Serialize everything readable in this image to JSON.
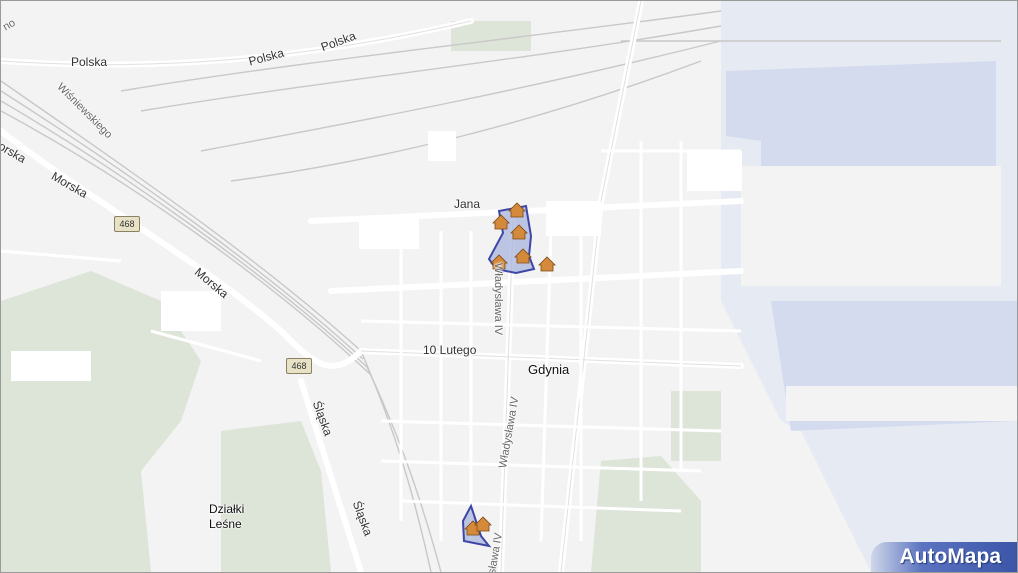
{
  "map": {
    "labels": {
      "polska_1": "Polska",
      "polska_2": "Polska",
      "polska_3": "Polska",
      "wisniewskiego": "Wiśniewskiego",
      "morska_1": "orska",
      "morska_2": "Morska",
      "morska_3": "Morska",
      "jana": "Jana",
      "lutego": "10 Lutego",
      "gdynia": "Gdynia",
      "wladyslawa_1": "Władysława IV",
      "wladyslawa_2": "Władysława IV",
      "wladyslawa_3": "sława IV",
      "slaska_1": "Śląska",
      "slaska_2": "Śląska",
      "dzialki": "Działki Leśne",
      "edge": "no"
    },
    "shields": {
      "road_1": "468",
      "road_2": "468"
    },
    "brand": "AutoMapa",
    "colors": {
      "sea": "#e6eaf3",
      "port": "#cdd6ec",
      "green": "#dde4d8",
      "highlight_fill": "#a9b4dd",
      "highlight_stroke": "#3e46a6",
      "house_icon": "#d48a3a"
    }
  }
}
